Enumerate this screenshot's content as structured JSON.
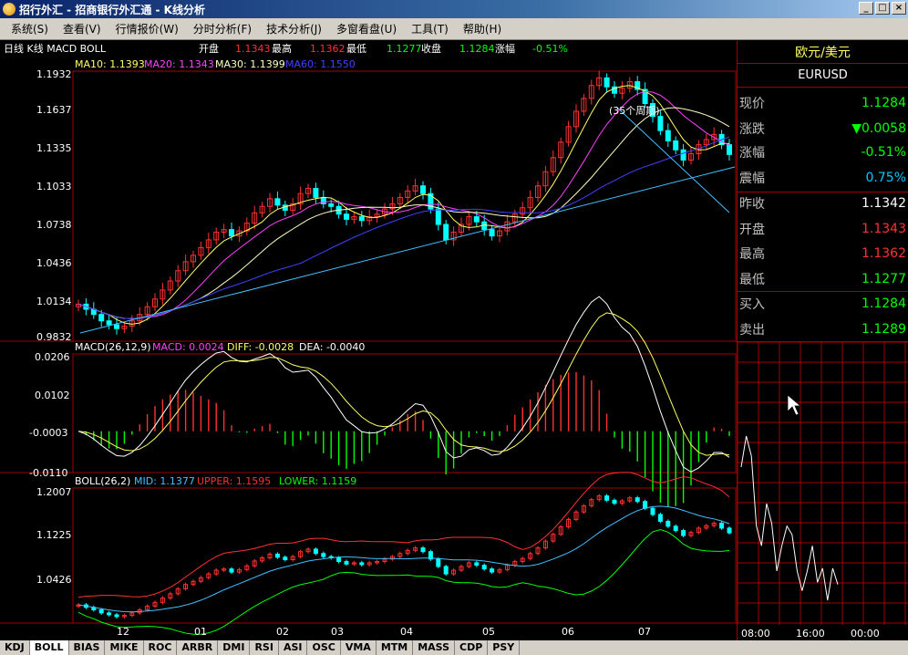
{
  "window": {
    "title": "招行外汇 - 招商银行外汇通 - K线分析",
    "buttons": {
      "minimize": "_",
      "restore": "□",
      "close": "×"
    }
  },
  "menu": [
    {
      "label": "系统(S)"
    },
    {
      "label": "查看(V)"
    },
    {
      "label": "行情报价(W)"
    },
    {
      "label": "分时分析(F)"
    },
    {
      "label": "技术分析(J)"
    },
    {
      "label": "多窗看盘(U)"
    },
    {
      "label": "工具(T)"
    },
    {
      "label": "帮助(H)"
    }
  ],
  "info_bar": {
    "period": "日线 K线 MACD BOLL",
    "open_label": "开盘",
    "open": "1.1343",
    "high_label": "最高",
    "high": "1.1362",
    "low_label": "最低",
    "low": "1.1277",
    "close_label": "收盘",
    "close": "1.1284",
    "change_label": "涨幅",
    "change": "-0.51%"
  },
  "ma_legend": {
    "ma10": "MA10: 1.1393",
    "ma20": "MA20: 1.1343",
    "ma30": "MA30: 1.1399",
    "ma60": "MA60: 1.1550"
  },
  "price_axis": [
    "1.1932",
    "1.1637",
    "1.1335",
    "1.1033",
    "1.0738",
    "1.0436",
    "1.0134",
    "0.9832"
  ],
  "annotation": "(35个周期)",
  "macd_legend": {
    "name": "MACD(26,12,9)",
    "macd": "MACD: 0.0024",
    "diff": "DIFF: -0.0028",
    "dea": "DEA: -0.0040"
  },
  "macd_axis": [
    "0.0206",
    "0.0102",
    "-0.0003",
    "-0.0110"
  ],
  "boll_legend": {
    "name": "BOLL(26,2)",
    "mid": "MID: 1.1377",
    "upper": "UPPER: 1.1595",
    "lower": "LOWER: 1.1159"
  },
  "boll_axis": [
    "1.2007",
    "1.1225",
    "1.0426"
  ],
  "time_axis": [
    "12",
    "01",
    "02",
    "03",
    "04",
    "05",
    "06",
    "07"
  ],
  "side": {
    "pair_name": "欧元/美元",
    "symbol": "EURUSD",
    "rows": [
      {
        "label": "现价",
        "value": "1.1284",
        "color": "#00ff00"
      },
      {
        "label": "涨跌",
        "value": "▼0.0058",
        "color": "#00ff00"
      },
      {
        "label": "涨幅",
        "value": "-0.51%",
        "color": "#00ff00"
      },
      {
        "label": "震幅",
        "value": "0.75%",
        "color": "#00c8ff"
      },
      {
        "label": "昨收",
        "value": "1.1342",
        "color": "#ffffff"
      },
      {
        "label": "开盘",
        "value": "1.1343",
        "color": "#ff3030"
      },
      {
        "label": "最高",
        "value": "1.1362",
        "color": "#ff3030"
      },
      {
        "label": "最低",
        "value": "1.1277",
        "color": "#00ff00"
      },
      {
        "label": "买入",
        "value": "1.1284",
        "color": "#00ff00"
      },
      {
        "label": "卖出",
        "value": "1.1289",
        "color": "#00ff00"
      }
    ],
    "intraday_times": [
      "08:00",
      "16:00",
      "00:00"
    ]
  },
  "tabs": [
    {
      "label": "KDJ"
    },
    {
      "label": "BOLL",
      "active": true
    },
    {
      "label": "BIAS"
    },
    {
      "label": "MIKE"
    },
    {
      "label": "ROC"
    },
    {
      "label": "ARBR"
    },
    {
      "label": "DMI"
    },
    {
      "label": "RSI"
    },
    {
      "label": "ASI"
    },
    {
      "label": "OSC"
    },
    {
      "label": "VMA"
    },
    {
      "label": "MTM"
    },
    {
      "label": "MASS"
    },
    {
      "label": "CDP"
    },
    {
      "label": "PSY"
    }
  ],
  "colors": {
    "up": "#ff3030",
    "down": "#00ffff",
    "ma10": "#ffff60",
    "ma20": "#ff40ff",
    "ma30": "#ffffc0",
    "ma60": "#4040ff",
    "grid": "#a00000"
  },
  "chart_data": [
    {
      "type": "candlestick",
      "title": "日线 K线",
      "ylim": [
        0.9832,
        1.1932
      ],
      "x_ticks": [
        "12",
        "01",
        "02",
        "03",
        "04",
        "05",
        "06",
        "07"
      ],
      "y_ticks": [
        1.1932,
        1.1637,
        1.1335,
        1.1033,
        1.0738,
        1.0436,
        1.0134,
        0.9832
      ],
      "close": [
        1.012,
        1.008,
        1.004,
        0.999,
        0.996,
        0.993,
        0.995,
        0.999,
        1.004,
        1.01,
        1.016,
        1.023,
        1.03,
        1.038,
        1.045,
        1.05,
        1.056,
        1.062,
        1.068,
        1.07,
        1.065,
        1.069,
        1.075,
        1.083,
        1.088,
        1.094,
        1.089,
        1.085,
        1.09,
        1.098,
        1.102,
        1.095,
        1.09,
        1.088,
        1.082,
        1.078,
        1.08,
        1.077,
        1.08,
        1.082,
        1.086,
        1.09,
        1.095,
        1.1,
        1.104,
        1.098,
        1.086,
        1.074,
        1.062,
        1.068,
        1.074,
        1.08,
        1.076,
        1.07,
        1.065,
        1.069,
        1.076,
        1.082,
        1.087,
        1.095,
        1.104,
        1.115,
        1.126,
        1.138,
        1.15,
        1.162,
        1.172,
        1.182,
        1.188,
        1.181,
        1.176,
        1.18,
        1.185,
        1.179,
        1.168,
        1.158,
        1.147,
        1.139,
        1.132,
        1.124,
        1.129,
        1.136,
        1.14,
        1.144,
        1.136,
        1.1284
      ],
      "indicators": [
        "MA10",
        "MA20",
        "MA30",
        "MA60"
      ],
      "legend": [
        "MA10: 1.1393",
        "MA20: 1.1343",
        "MA30: 1.1399",
        "MA60: 1.1550"
      ]
    },
    {
      "type": "bar",
      "title": "MACD(26,12,9)",
      "ylim": [
        -0.011,
        0.0206
      ],
      "y_ticks": [
        0.0206,
        0.0102,
        -0.0003,
        -0.011
      ],
      "series": [
        {
          "name": "DIFF"
        },
        {
          "name": "DEA"
        },
        {
          "name": "MACD"
        }
      ],
      "legend": [
        "MACD: 0.0024",
        "DIFF: -0.0028",
        "DEA: -0.0040"
      ]
    },
    {
      "type": "line",
      "title": "BOLL(26,2)",
      "ylim": [
        1.0426,
        1.2007
      ],
      "y_ticks": [
        1.2007,
        1.1225,
        1.0426
      ],
      "series": [
        {
          "name": "MID"
        },
        {
          "name": "UPPER"
        },
        {
          "name": "LOWER"
        }
      ],
      "legend": [
        "MID: 1.1377",
        "UPPER: 1.1595",
        "LOWER: 1.1159"
      ]
    },
    {
      "type": "line",
      "title": "EURUSD",
      "x_ticks": [
        "08:00",
        "16:00",
        "00:00"
      ],
      "series": [
        {
          "values": [
            1.1335,
            1.135,
            1.134,
            1.131,
            1.13,
            1.132,
            1.131,
            1.129,
            1.13,
            1.131,
            1.1305,
            1.129,
            1.128,
            1.129,
            1.13,
            1.1285,
            1.129,
            1.1277,
            1.129,
            1.1284
          ]
        }
      ]
    }
  ]
}
